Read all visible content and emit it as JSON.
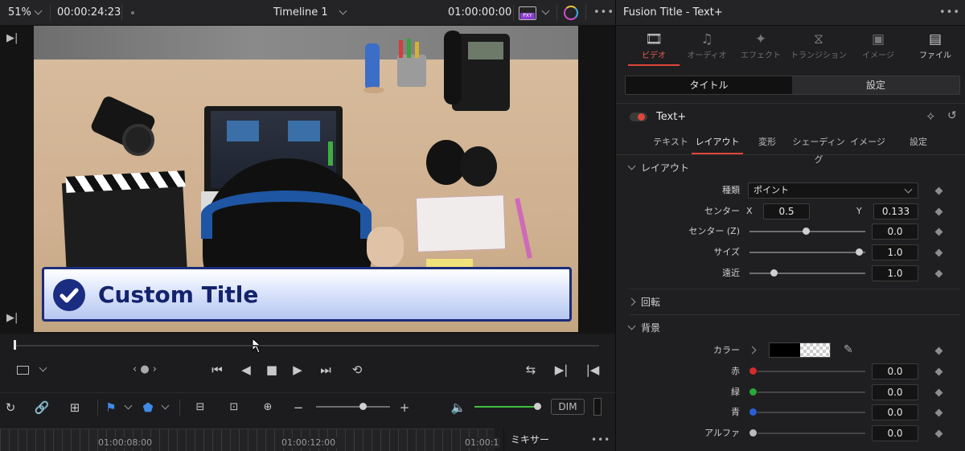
{
  "viewer": {
    "zoom": "51%",
    "timecode": "00:00:24:23",
    "timeline_name": "Timeline 1",
    "timeline_timecode": "01:00:00:00",
    "proxy_label": "PXY"
  },
  "title_overlay": {
    "text": "Custom Title"
  },
  "toolbar": {
    "dim_label": "DIM",
    "volume_level": 0.93
  },
  "ruler": {
    "ticks": [
      "01:00:08:00",
      "01:00:12:00",
      "01:00:1"
    ],
    "mixer_label": "ミキサー"
  },
  "inspector": {
    "title": "Fusion Title - Text+",
    "tabs": [
      {
        "label": "ビデオ",
        "icon": "film-icon"
      },
      {
        "label": "オーディオ",
        "icon": "music-icon"
      },
      {
        "label": "エフェクト",
        "icon": "wand-icon"
      },
      {
        "label": "トランジション",
        "icon": "transition-icon"
      },
      {
        "label": "イメージ",
        "icon": "image-icon"
      },
      {
        "label": "ファイル",
        "icon": "file-icon"
      }
    ],
    "segment": {
      "left": "タイトル",
      "right": "設定"
    },
    "node_name": "Text+",
    "subtabs": [
      "テキスト",
      "レイアウト",
      "変形",
      "シェーディング",
      "イメージ",
      "設定"
    ],
    "layout": {
      "section": "レイアウト",
      "type_label": "種類",
      "type_value": "ポイント",
      "center_label": "センター",
      "center_x_label": "X",
      "center_x": "0.5",
      "center_y_label": "Y",
      "center_y": "0.133",
      "center_z_label": "センター (Z)",
      "center_z": "0.0",
      "size_label": "サイズ",
      "size": "1.0",
      "perspective_label": "遠近",
      "perspective": "1.0"
    },
    "rotation_section": "回転",
    "background": {
      "section": "背景",
      "color_label": "カラー",
      "red_label": "赤",
      "red": "0.0",
      "green_label": "緑",
      "green": "0.0",
      "blue_label": "青",
      "blue": "0.0",
      "alpha_label": "アルファ",
      "alpha": "0.0"
    }
  },
  "colors": {
    "accent_red": "#e0463a",
    "title_navy": "#1a2d80",
    "volume_green": "#3fbf3f"
  }
}
